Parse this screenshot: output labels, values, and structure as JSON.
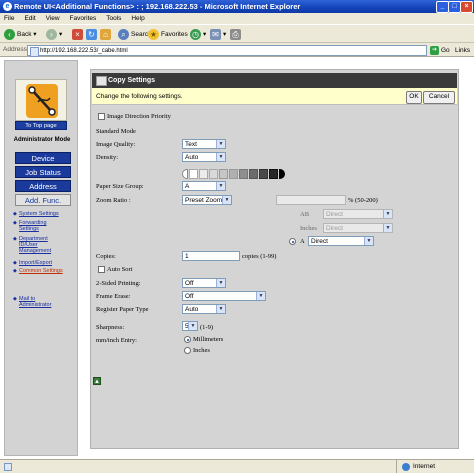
{
  "window": {
    "title": "Remote UI<Additional Functions> : ; 192.168.222.53 - Microsoft Internet Explorer"
  },
  "menu": [
    "File",
    "Edit",
    "View",
    "Favorites",
    "Tools",
    "Help"
  ],
  "toolbar": {
    "back": "Back",
    "search": "Search",
    "favorites": "Favorites"
  },
  "address": {
    "label": "Address",
    "url": "http://192.168.222.53/_cabe.html",
    "go": "Go",
    "links": "Links"
  },
  "sidebar": {
    "to_top": "To Top page",
    "admin_mode": "Administrator Mode",
    "nav": [
      "Device",
      "Job Status",
      "Address",
      "Add. Func."
    ],
    "links": [
      "System Settings",
      "Forwarding Settings",
      "Department ID/User Management",
      "Import/Export",
      "Common Settings"
    ],
    "mail": "Mail to Administrator"
  },
  "page": {
    "title": "Copy Settings",
    "notice": "Change the following settings.",
    "ok": "OK",
    "cancel": "Cancel",
    "image_direction": "Image Direction Priority",
    "standard_mode": "Standard Mode",
    "image_quality": {
      "label": "Image Quality:",
      "value": "Text"
    },
    "density": {
      "label": "Density:",
      "value": "Auto"
    },
    "paper_size_group": {
      "label": "Paper Size Group:",
      "value": "A"
    },
    "zoom_ratio": {
      "label": "Zoom Ratio :",
      "value": "Preset Zoom",
      "range": "% (50-200)",
      "ab_label": "AB",
      "ab_value": "Direct",
      "inches_label": "Inches",
      "inches_value": "Direct",
      "a_label": "A",
      "a_value": "Direct"
    },
    "copies": {
      "label": "Copies:",
      "value": "1",
      "range": "copies (1-99)"
    },
    "auto_sort": "Auto Sort",
    "two_sided": {
      "label": "2-Sided Printing:",
      "value": "Off"
    },
    "frame_erase": {
      "label": "Frame Erase:",
      "value": "Off"
    },
    "register_paper": {
      "label": "Register Paper Type",
      "value": "Auto"
    },
    "sharpness": {
      "label": "Sharpness:",
      "value": "5",
      "range": "(1-9)"
    },
    "mm_inch": {
      "label": "mm/inch Entry:",
      "options": [
        "Millimeters",
        "Inches"
      ],
      "selected": "Millimeters"
    }
  },
  "status": {
    "zone": "Internet"
  }
}
